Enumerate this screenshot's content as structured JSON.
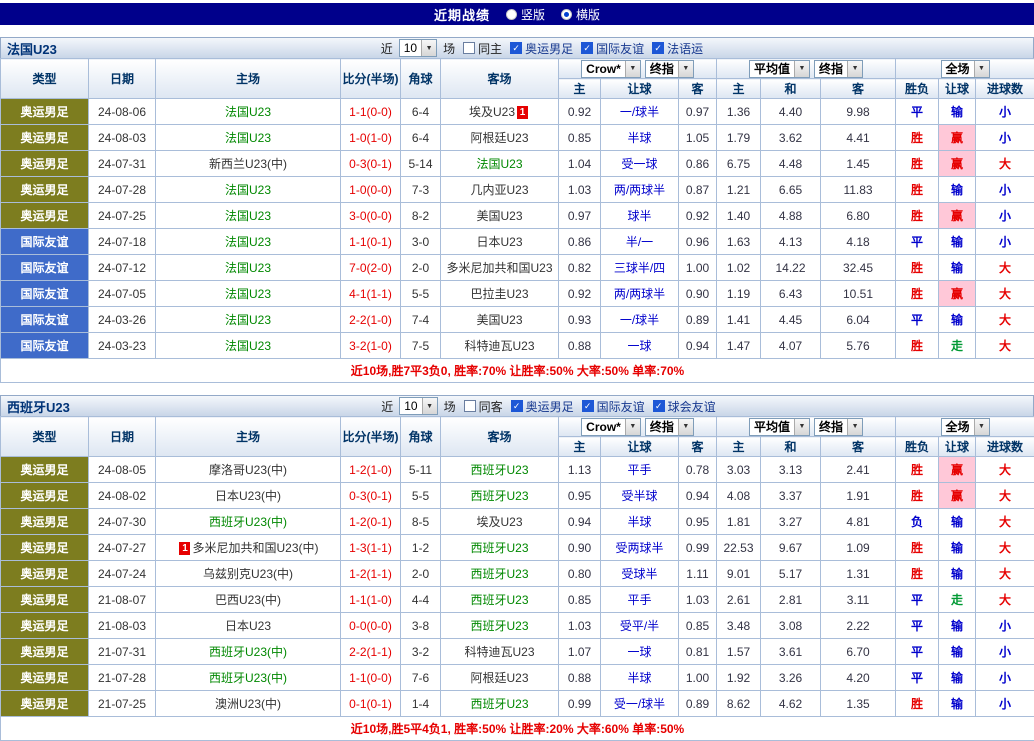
{
  "top_bar": {
    "title": "近期战绩",
    "vertical_label": "竖版",
    "horizontal_label": "横版",
    "selected": "横版"
  },
  "colors": {
    "topbar_bg": "#00008b",
    "type_bg": {
      "奥运男足": "#7d7d1f",
      "国际友谊": "#3f6bc9"
    },
    "focus_team": "#008800",
    "normal_team": "#333333",
    "score": "#e60000",
    "handicap": "#0000cc",
    "result": {
      "胜": "#e60000",
      "平": "#0000cc",
      "负": "#0000cc",
      "赢": "#e60000",
      "输": "#0000cc",
      "走": "#009933",
      "大": "#e60000",
      "小": "#0000cc"
    },
    "win_highlight_bg": "#ffc8d8",
    "summary": "#e60000",
    "badge_bg": "#e60000"
  },
  "table_header": {
    "static_cols": [
      "类型",
      "日期",
      "主场",
      "比分(半场)",
      "角球",
      "客场"
    ],
    "groups": [
      {
        "selects": [
          "Crow*",
          "终指"
        ],
        "cols": [
          "主",
          "让球",
          "客"
        ]
      },
      {
        "selects": [
          "平均值",
          "终指"
        ],
        "cols": [
          "主",
          "和",
          "客"
        ]
      },
      {
        "selects": [
          "全场"
        ],
        "cols": [
          "胜负",
          "让球",
          "进球数"
        ]
      }
    ]
  },
  "sections": [
    {
      "team": "法国U23",
      "filter": {
        "prefix": "近",
        "count": "10",
        "suffix": "场",
        "same_side": {
          "label": "同主",
          "checked": false
        },
        "competitions": [
          {
            "label": "奥运男足",
            "checked": true
          },
          {
            "label": "国际友谊",
            "checked": true
          },
          {
            "label": "法语运",
            "checked": true
          }
        ]
      },
      "rows": [
        {
          "type": "奥运男足",
          "date": "24-08-06",
          "home": {
            "name": "法国U23",
            "focus": true
          },
          "score": "1-1(0-0)",
          "corners": "6-4",
          "away": {
            "name": "埃及U23",
            "badge": "1",
            "badge_pos": "after"
          },
          "odds": [
            "0.92",
            "一/球半",
            "0.97",
            "1.36",
            "4.40",
            "9.98"
          ],
          "results": [
            "平",
            "输",
            "小"
          ]
        },
        {
          "type": "奥运男足",
          "date": "24-08-03",
          "home": {
            "name": "法国U23",
            "focus": true
          },
          "score": "1-0(1-0)",
          "corners": "6-4",
          "away": {
            "name": "阿根廷U23"
          },
          "odds": [
            "0.85",
            "半球",
            "1.05",
            "1.79",
            "3.62",
            "4.41"
          ],
          "results": [
            "胜",
            "赢",
            "小"
          ]
        },
        {
          "type": "奥运男足",
          "date": "24-07-31",
          "home": {
            "name": "新西兰U23(中)"
          },
          "score": "0-3(0-1)",
          "corners": "5-14",
          "away": {
            "name": "法国U23",
            "focus": true
          },
          "odds": [
            "1.04",
            "受一球",
            "0.86",
            "6.75",
            "4.48",
            "1.45"
          ],
          "results": [
            "胜",
            "赢",
            "大"
          ]
        },
        {
          "type": "奥运男足",
          "date": "24-07-28",
          "home": {
            "name": "法国U23",
            "focus": true
          },
          "score": "1-0(0-0)",
          "corners": "7-3",
          "away": {
            "name": "几内亚U23"
          },
          "odds": [
            "1.03",
            "两/两球半",
            "0.87",
            "1.21",
            "6.65",
            "11.83"
          ],
          "results": [
            "胜",
            "输",
            "小"
          ]
        },
        {
          "type": "奥运男足",
          "date": "24-07-25",
          "home": {
            "name": "法国U23",
            "focus": true
          },
          "score": "3-0(0-0)",
          "corners": "8-2",
          "away": {
            "name": "美国U23"
          },
          "odds": [
            "0.97",
            "球半",
            "0.92",
            "1.40",
            "4.88",
            "6.80"
          ],
          "results": [
            "胜",
            "赢",
            "小"
          ]
        },
        {
          "type": "国际友谊",
          "date": "24-07-18",
          "home": {
            "name": "法国U23",
            "focus": true
          },
          "score": "1-1(0-1)",
          "corners": "3-0",
          "away": {
            "name": "日本U23"
          },
          "odds": [
            "0.86",
            "半/一",
            "0.96",
            "1.63",
            "4.13",
            "4.18"
          ],
          "results": [
            "平",
            "输",
            "小"
          ]
        },
        {
          "type": "国际友谊",
          "date": "24-07-12",
          "home": {
            "name": "法国U23",
            "focus": true
          },
          "score": "7-0(2-0)",
          "corners": "2-0",
          "away": {
            "name": "多米尼加共和国U23"
          },
          "odds": [
            "0.82",
            "三球半/四",
            "1.00",
            "1.02",
            "14.22",
            "32.45"
          ],
          "results": [
            "胜",
            "输",
            "大"
          ]
        },
        {
          "type": "国际友谊",
          "date": "24-07-05",
          "home": {
            "name": "法国U23",
            "focus": true
          },
          "score": "4-1(1-1)",
          "corners": "5-5",
          "away": {
            "name": "巴拉圭U23"
          },
          "odds": [
            "0.92",
            "两/两球半",
            "0.90",
            "1.19",
            "6.43",
            "10.51"
          ],
          "results": [
            "胜",
            "赢",
            "大"
          ]
        },
        {
          "type": "国际友谊",
          "date": "24-03-26",
          "home": {
            "name": "法国U23",
            "focus": true
          },
          "score": "2-2(1-0)",
          "corners": "7-4",
          "away": {
            "name": "美国U23"
          },
          "odds": [
            "0.93",
            "一/球半",
            "0.89",
            "1.41",
            "4.45",
            "6.04"
          ],
          "results": [
            "平",
            "输",
            "大"
          ]
        },
        {
          "type": "国际友谊",
          "date": "24-03-23",
          "home": {
            "name": "法国U23",
            "focus": true
          },
          "score": "3-2(1-0)",
          "corners": "7-5",
          "away": {
            "name": "科特迪瓦U23"
          },
          "odds": [
            "0.88",
            "一球",
            "0.94",
            "1.47",
            "4.07",
            "5.76"
          ],
          "results": [
            "胜",
            "走",
            "大"
          ]
        }
      ],
      "summary": "近10场,胜7平3负0, 胜率:70% 让胜率:50% 大率:50% 单率:70%"
    },
    {
      "team": "西班牙U23",
      "filter": {
        "prefix": "近",
        "count": "10",
        "suffix": "场",
        "same_side": {
          "label": "同客",
          "checked": false
        },
        "competitions": [
          {
            "label": "奥运男足",
            "checked": true
          },
          {
            "label": "国际友谊",
            "checked": true
          },
          {
            "label": "球会友谊",
            "checked": true
          }
        ]
      },
      "rows": [
        {
          "type": "奥运男足",
          "date": "24-08-05",
          "home": {
            "name": "摩洛哥U23(中)"
          },
          "score": "1-2(1-0)",
          "corners": "5-11",
          "away": {
            "name": "西班牙U23",
            "focus": true
          },
          "odds": [
            "1.13",
            "平手",
            "0.78",
            "3.03",
            "3.13",
            "2.41"
          ],
          "results": [
            "胜",
            "赢",
            "大"
          ]
        },
        {
          "type": "奥运男足",
          "date": "24-08-02",
          "home": {
            "name": "日本U23(中)"
          },
          "score": "0-3(0-1)",
          "corners": "5-5",
          "away": {
            "name": "西班牙U23",
            "focus": true
          },
          "odds": [
            "0.95",
            "受半球",
            "0.94",
            "4.08",
            "3.37",
            "1.91"
          ],
          "results": [
            "胜",
            "赢",
            "大"
          ]
        },
        {
          "type": "奥运男足",
          "date": "24-07-30",
          "home": {
            "name": "西班牙U23(中)",
            "focus": true
          },
          "score": "1-2(0-1)",
          "corners": "8-5",
          "away": {
            "name": "埃及U23"
          },
          "odds": [
            "0.94",
            "半球",
            "0.95",
            "1.81",
            "3.27",
            "4.81"
          ],
          "results": [
            "负",
            "输",
            "大"
          ]
        },
        {
          "type": "奥运男足",
          "date": "24-07-27",
          "home": {
            "name": "多米尼加共和国U23(中)",
            "badge": "1",
            "badge_pos": "before"
          },
          "score": "1-3(1-1)",
          "corners": "1-2",
          "away": {
            "name": "西班牙U23",
            "focus": true
          },
          "odds": [
            "0.90",
            "受两球半",
            "0.99",
            "22.53",
            "9.67",
            "1.09"
          ],
          "results": [
            "胜",
            "输",
            "大"
          ]
        },
        {
          "type": "奥运男足",
          "date": "24-07-24",
          "home": {
            "name": "乌兹别克U23(中)"
          },
          "score": "1-2(1-1)",
          "corners": "2-0",
          "away": {
            "name": "西班牙U23",
            "focus": true
          },
          "odds": [
            "0.80",
            "受球半",
            "1.11",
            "9.01",
            "5.17",
            "1.31"
          ],
          "results": [
            "胜",
            "输",
            "大"
          ]
        },
        {
          "type": "奥运男足",
          "date": "21-08-07",
          "home": {
            "name": "巴西U23(中)"
          },
          "score": "1-1(1-0)",
          "corners": "4-4",
          "away": {
            "name": "西班牙U23",
            "focus": true
          },
          "odds": [
            "0.85",
            "平手",
            "1.03",
            "2.61",
            "2.81",
            "3.11"
          ],
          "results": [
            "平",
            "走",
            "大"
          ]
        },
        {
          "type": "奥运男足",
          "date": "21-08-03",
          "home": {
            "name": "日本U23"
          },
          "score": "0-0(0-0)",
          "corners": "3-8",
          "away": {
            "name": "西班牙U23",
            "focus": true
          },
          "odds": [
            "1.03",
            "受平/半",
            "0.85",
            "3.48",
            "3.08",
            "2.22"
          ],
          "results": [
            "平",
            "输",
            "小"
          ]
        },
        {
          "type": "奥运男足",
          "date": "21-07-31",
          "home": {
            "name": "西班牙U23(中)",
            "focus": true
          },
          "score": "2-2(1-1)",
          "corners": "3-2",
          "away": {
            "name": "科特迪瓦U23"
          },
          "odds": [
            "1.07",
            "一球",
            "0.81",
            "1.57",
            "3.61",
            "6.70"
          ],
          "results": [
            "平",
            "输",
            "小"
          ]
        },
        {
          "type": "奥运男足",
          "date": "21-07-28",
          "home": {
            "name": "西班牙U23(中)",
            "focus": true
          },
          "score": "1-1(0-0)",
          "corners": "7-6",
          "away": {
            "name": "阿根廷U23"
          },
          "odds": [
            "0.88",
            "半球",
            "1.00",
            "1.92",
            "3.26",
            "4.20"
          ],
          "results": [
            "平",
            "输",
            "小"
          ]
        },
        {
          "type": "奥运男足",
          "date": "21-07-25",
          "home": {
            "name": "澳洲U23(中)"
          },
          "score": "0-1(0-1)",
          "corners": "1-4",
          "away": {
            "name": "西班牙U23",
            "focus": true
          },
          "odds": [
            "0.99",
            "受一/球半",
            "0.89",
            "8.62",
            "4.62",
            "1.35"
          ],
          "results": [
            "胜",
            "输",
            "小"
          ]
        }
      ],
      "summary": "近10场,胜5平4负1, 胜率:50% 让胜率:20% 大率:60% 单率:50%"
    }
  ]
}
